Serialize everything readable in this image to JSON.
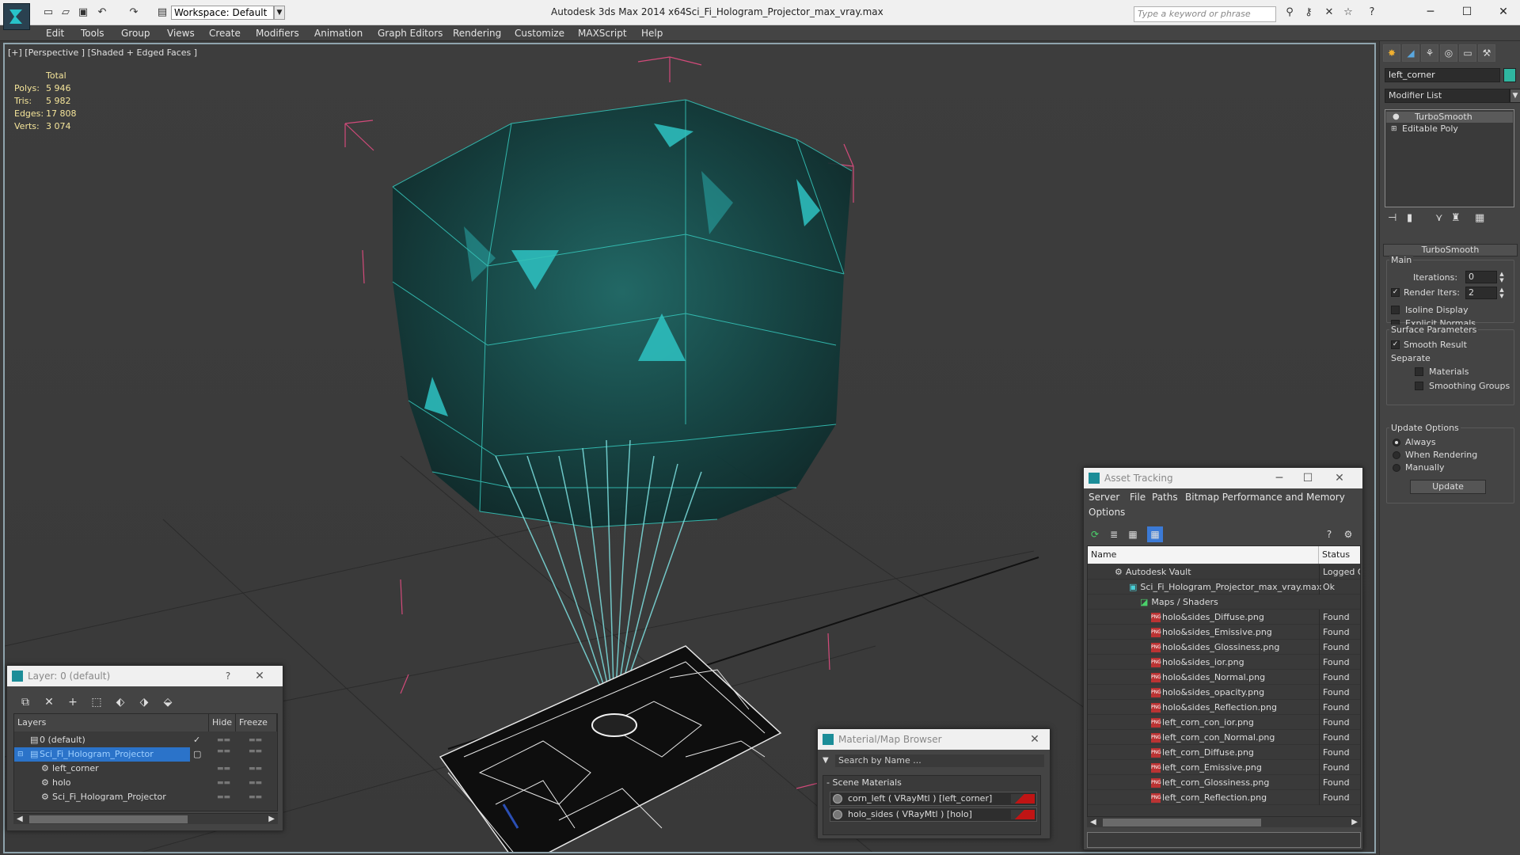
{
  "titlebar": {
    "workspace": "Workspace: Default",
    "app_title": "Autodesk 3ds Max  2014 x64",
    "file_name": "Sci_Fi_Hologram_Projector_max_vray.max",
    "search_placeholder": "Type a keyword or phrase"
  },
  "menu": [
    "Edit",
    "Tools",
    "Group",
    "Views",
    "Create",
    "Modifiers",
    "Animation",
    "Graph Editors",
    "Rendering",
    "Customize",
    "MAXScript",
    "Help"
  ],
  "viewport": {
    "label": "[+] [Perspective ] [Shaded + Edged Faces ]",
    "stats": {
      "total_label": "Total",
      "rows": [
        {
          "label": "Polys:",
          "value": "5 946"
        },
        {
          "label": "Tris:",
          "value": "5 982"
        },
        {
          "label": "Edges:",
          "value": "17 808"
        },
        {
          "label": "Verts:",
          "value": "3 074"
        }
      ]
    }
  },
  "command_panel": {
    "object_name": "left_corner",
    "object_color": "#2fb6a0",
    "modifier_list": "Modifier List",
    "stack": [
      "TurboSmooth",
      "Editable Poly"
    ],
    "turbosmooth": {
      "title": "TurboSmooth",
      "main": "Main",
      "iterations_label": "Iterations:",
      "iterations": "0",
      "render_iters_label": "Render Iters:",
      "render_iters": "2",
      "isoline": "Isoline Display",
      "explicit": "Explicit Normals",
      "surface": "Surface Parameters",
      "smooth_result": "Smooth Result",
      "separate": "Separate",
      "materials": "Materials",
      "smoothing_groups": "Smoothing Groups",
      "update_options": "Update Options",
      "always": "Always",
      "when_rendering": "When Rendering",
      "manually": "Manually",
      "update": "Update"
    }
  },
  "layer_window": {
    "title": "Layer: 0 (default)",
    "help": "?",
    "col_layers": "Layers",
    "col_hide": "Hide",
    "col_freeze": "Freeze",
    "rows": [
      "0 (default)",
      "Sci_Fi_Hologram_Projector",
      "left_corner",
      "holo",
      "Sci_Fi_Hologram_Projector"
    ]
  },
  "material_browser": {
    "title": "Material/Map Browser",
    "search": "Search by Name ...",
    "section": "- Scene Materials",
    "materials": [
      "corn_left  ( VRayMtl ) [left_corner]",
      "holo_sides  ( VRayMtl ) [holo]"
    ]
  },
  "asset_tracking": {
    "title": "Asset Tracking",
    "menus": [
      "Server",
      "File",
      "Paths",
      "Bitmap Performance and Memory",
      "Options"
    ],
    "col_name": "Name",
    "col_status": "Status",
    "rows": [
      {
        "name": "Autodesk Vault",
        "status": "Logged Ou"
      },
      {
        "name": "Sci_Fi_Hologram_Projector_max_vray.max",
        "status": "Ok"
      },
      {
        "name": "Maps / Shaders",
        "status": ""
      },
      {
        "name": "holo&sides_Diffuse.png",
        "status": "Found"
      },
      {
        "name": "holo&sides_Emissive.png",
        "status": "Found"
      },
      {
        "name": "holo&sides_Glossiness.png",
        "status": "Found"
      },
      {
        "name": "holo&sides_ior.png",
        "status": "Found"
      },
      {
        "name": "holo&sides_Normal.png",
        "status": "Found"
      },
      {
        "name": "holo&sides_opacity.png",
        "status": "Found"
      },
      {
        "name": "holo&sides_Reflection.png",
        "status": "Found"
      },
      {
        "name": "left_corn_con_ior.png",
        "status": "Found"
      },
      {
        "name": "left_corn_con_Normal.png",
        "status": "Found"
      },
      {
        "name": "left_corn_Diffuse.png",
        "status": "Found"
      },
      {
        "name": "left_corn_Emissive.png",
        "status": "Found"
      },
      {
        "name": "left_corn_Glossiness.png",
        "status": "Found"
      },
      {
        "name": "left_corn_Reflection.png",
        "status": "Found"
      }
    ]
  }
}
